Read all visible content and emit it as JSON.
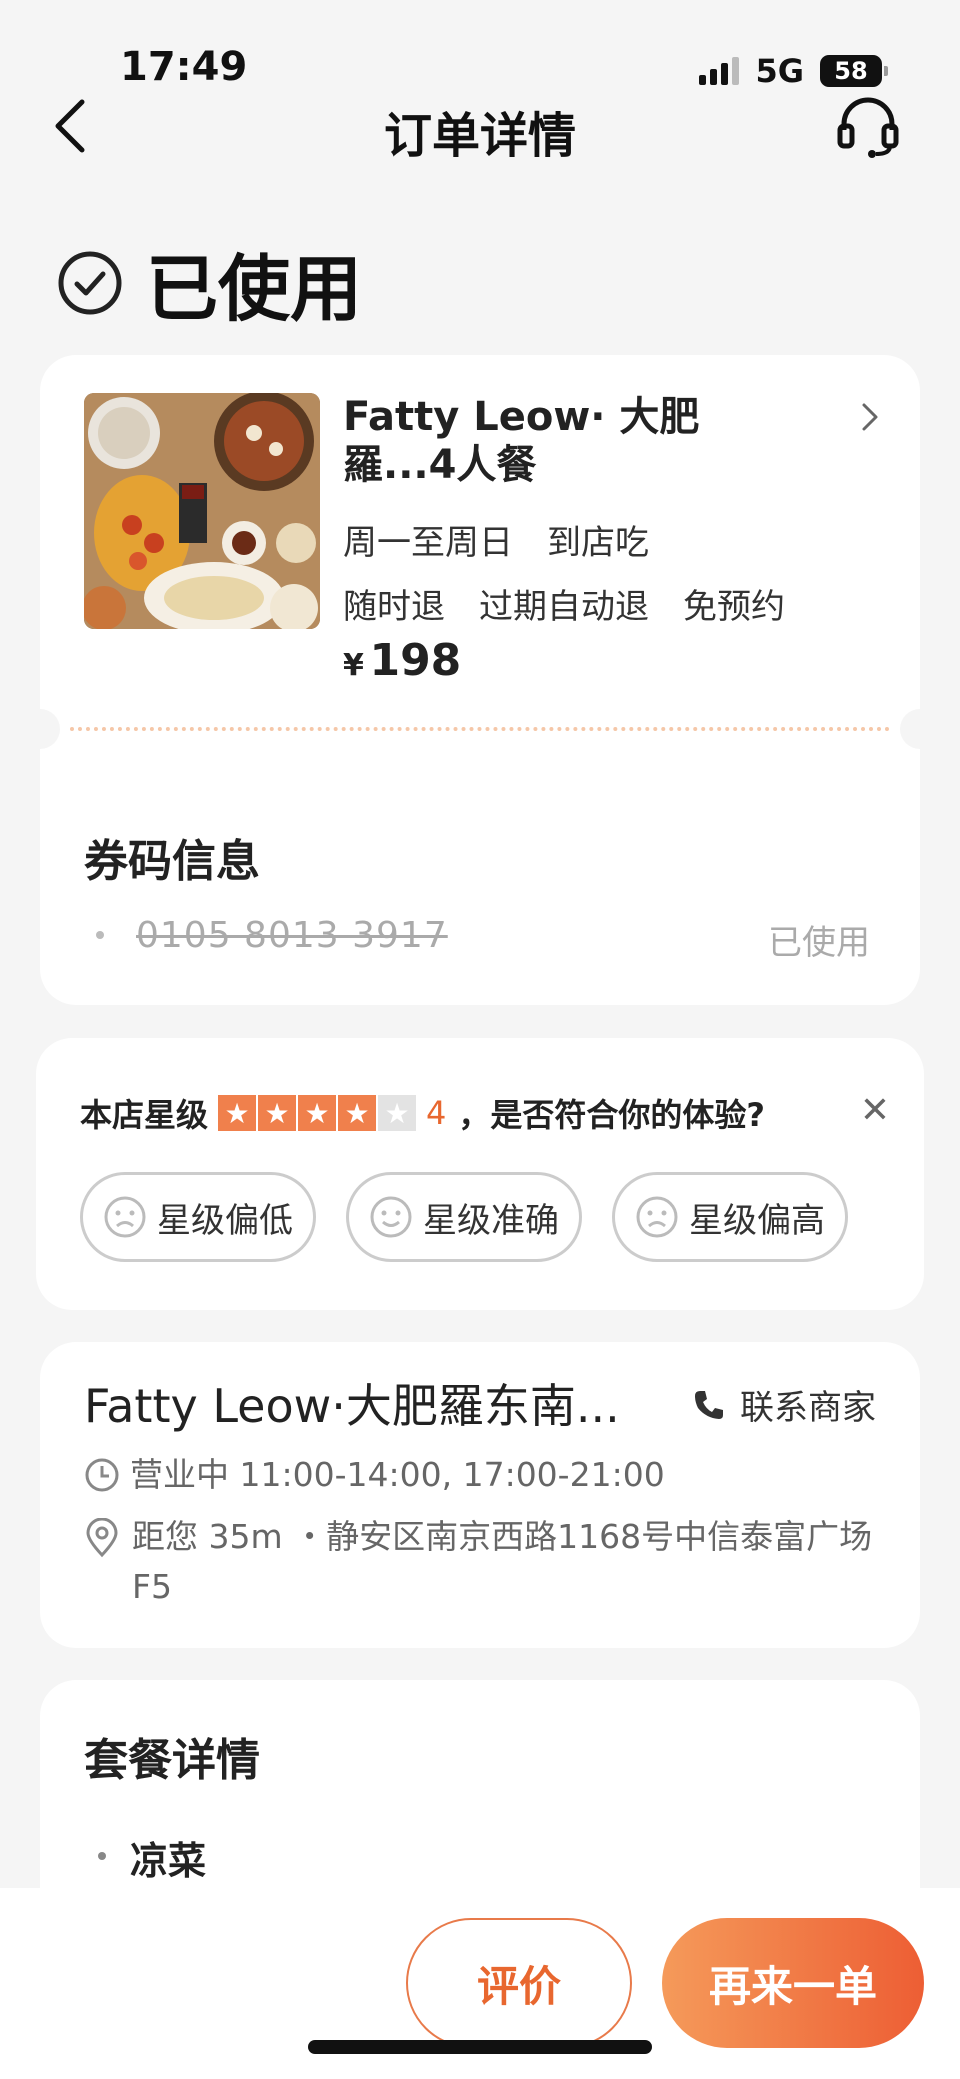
{
  "status_bar": {
    "time": "17:49",
    "network": "5G",
    "battery": "58"
  },
  "nav": {
    "title": "订单详情"
  },
  "order_status": {
    "label": "已使用"
  },
  "product": {
    "name": "Fatty Leow· 大肥羅...4人餐",
    "days": "周一至周日",
    "mode": "到店吃",
    "tags": [
      "随时退",
      "过期自动退",
      "免预约"
    ],
    "currency": "¥",
    "price": "198"
  },
  "coupon": {
    "title": "券码信息",
    "code": "0105 8013 3917",
    "status": "已使用"
  },
  "rating": {
    "label": "本店星级",
    "stars": 4,
    "max_stars": 5,
    "score": "4",
    "question": "，是否符合你的体验?",
    "options": [
      "星级偏低",
      "星级准确",
      "星级偏高"
    ]
  },
  "shop": {
    "name": "Fatty Leow·大肥羅东南...",
    "contact": "联系商家",
    "hours": "营业中 11:00-14:00, 17:00-21:00",
    "address": "距您 35m ・静安区南京西路1168号中信泰富广场F5"
  },
  "package": {
    "title": "套餐详情",
    "first_item": "凉菜"
  },
  "actions": {
    "review": "评价",
    "reorder": "再来一单"
  },
  "colors": {
    "accent": "#e8672f",
    "star": "#f0804c",
    "background": "#f5f5f5"
  }
}
